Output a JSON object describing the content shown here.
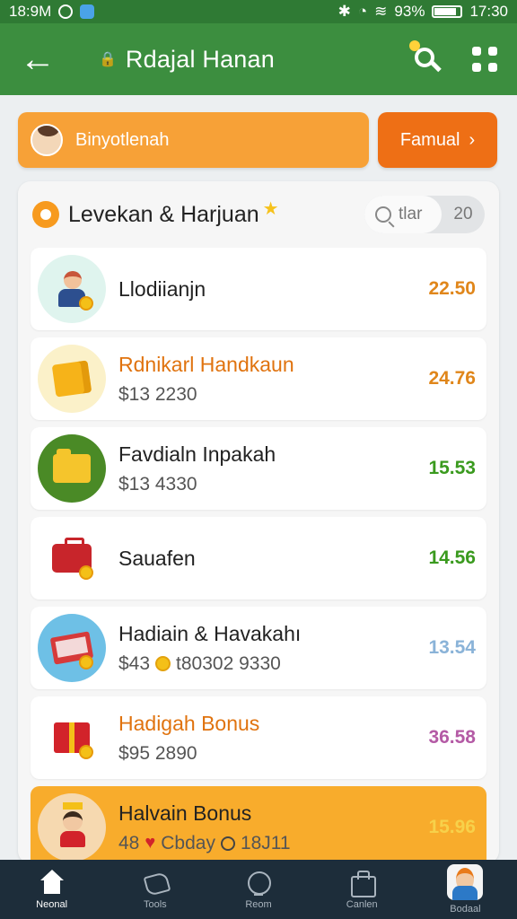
{
  "status_bar": {
    "time_left": "18:9M",
    "battery": "93%",
    "time_right": "17:30"
  },
  "app_bar": {
    "title": "Rdajal Hanan",
    "back_icon": "arrow-left-icon",
    "search_icon": "search-icon",
    "menu_icon": "grid-icon"
  },
  "promo": {
    "banner_label": "Binyotlenah",
    "button_label": "Famual",
    "button_chevron": "›"
  },
  "list_card": {
    "title": "Levekan & Harjuan",
    "search_placeholder": "tlar",
    "count": "20"
  },
  "items": [
    {
      "name": "Llodiianjn",
      "sub": "",
      "value": "22.50",
      "value_color": "#e0861a",
      "name_style": "normal",
      "icon": "person-icon",
      "bg": "mint"
    },
    {
      "name": "Rdnikarl Handkaun",
      "sub": "$13 2230",
      "value": "24.76",
      "value_color": "#e0861a",
      "name_style": "orange",
      "icon": "box-icon",
      "bg": "cream"
    },
    {
      "name": "Favdialn Inpakah",
      "sub": "$13 4330",
      "value": "15.53",
      "value_color": "#3a9a1e",
      "name_style": "normal",
      "icon": "folder-icon",
      "bg": "green"
    },
    {
      "name": "Sauafen",
      "sub": "",
      "value": "14.56",
      "value_color": "#3a9a1e",
      "name_style": "normal",
      "icon": "briefcase-icon",
      "bg": "white"
    },
    {
      "name": "Hadiain & Havakahı",
      "sub_prefix": "$43",
      "sub_rest": "t80302 9330",
      "value": "13.54",
      "value_color": "#8ab3d8",
      "name_style": "normal",
      "icon": "laptop-icon",
      "bg": "sky"
    },
    {
      "name": "Hadigah Bonus",
      "sub": "$95 2890",
      "value": "36.58",
      "value_color": "#b45aa5",
      "name_style": "orange",
      "icon": "gift-icon",
      "bg": "white"
    },
    {
      "name": "Halvain Bonus",
      "sub_prefix": "48",
      "sub_mid": "Cbday",
      "sub_rest": "18J11",
      "value": "15.96",
      "value_color": "#f7d14a",
      "name_style": "normal",
      "icon": "kid-icon",
      "bg": "peach"
    }
  ],
  "bottom_nav": [
    {
      "label": "Neonal",
      "icon": "home-icon"
    },
    {
      "label": "Tools",
      "icon": "tools-icon"
    },
    {
      "label": "Reom",
      "icon": "circle-icon"
    },
    {
      "label": "Canlen",
      "icon": "bag-icon"
    },
    {
      "label": "Bodaal",
      "icon": "avatar-icon"
    }
  ]
}
